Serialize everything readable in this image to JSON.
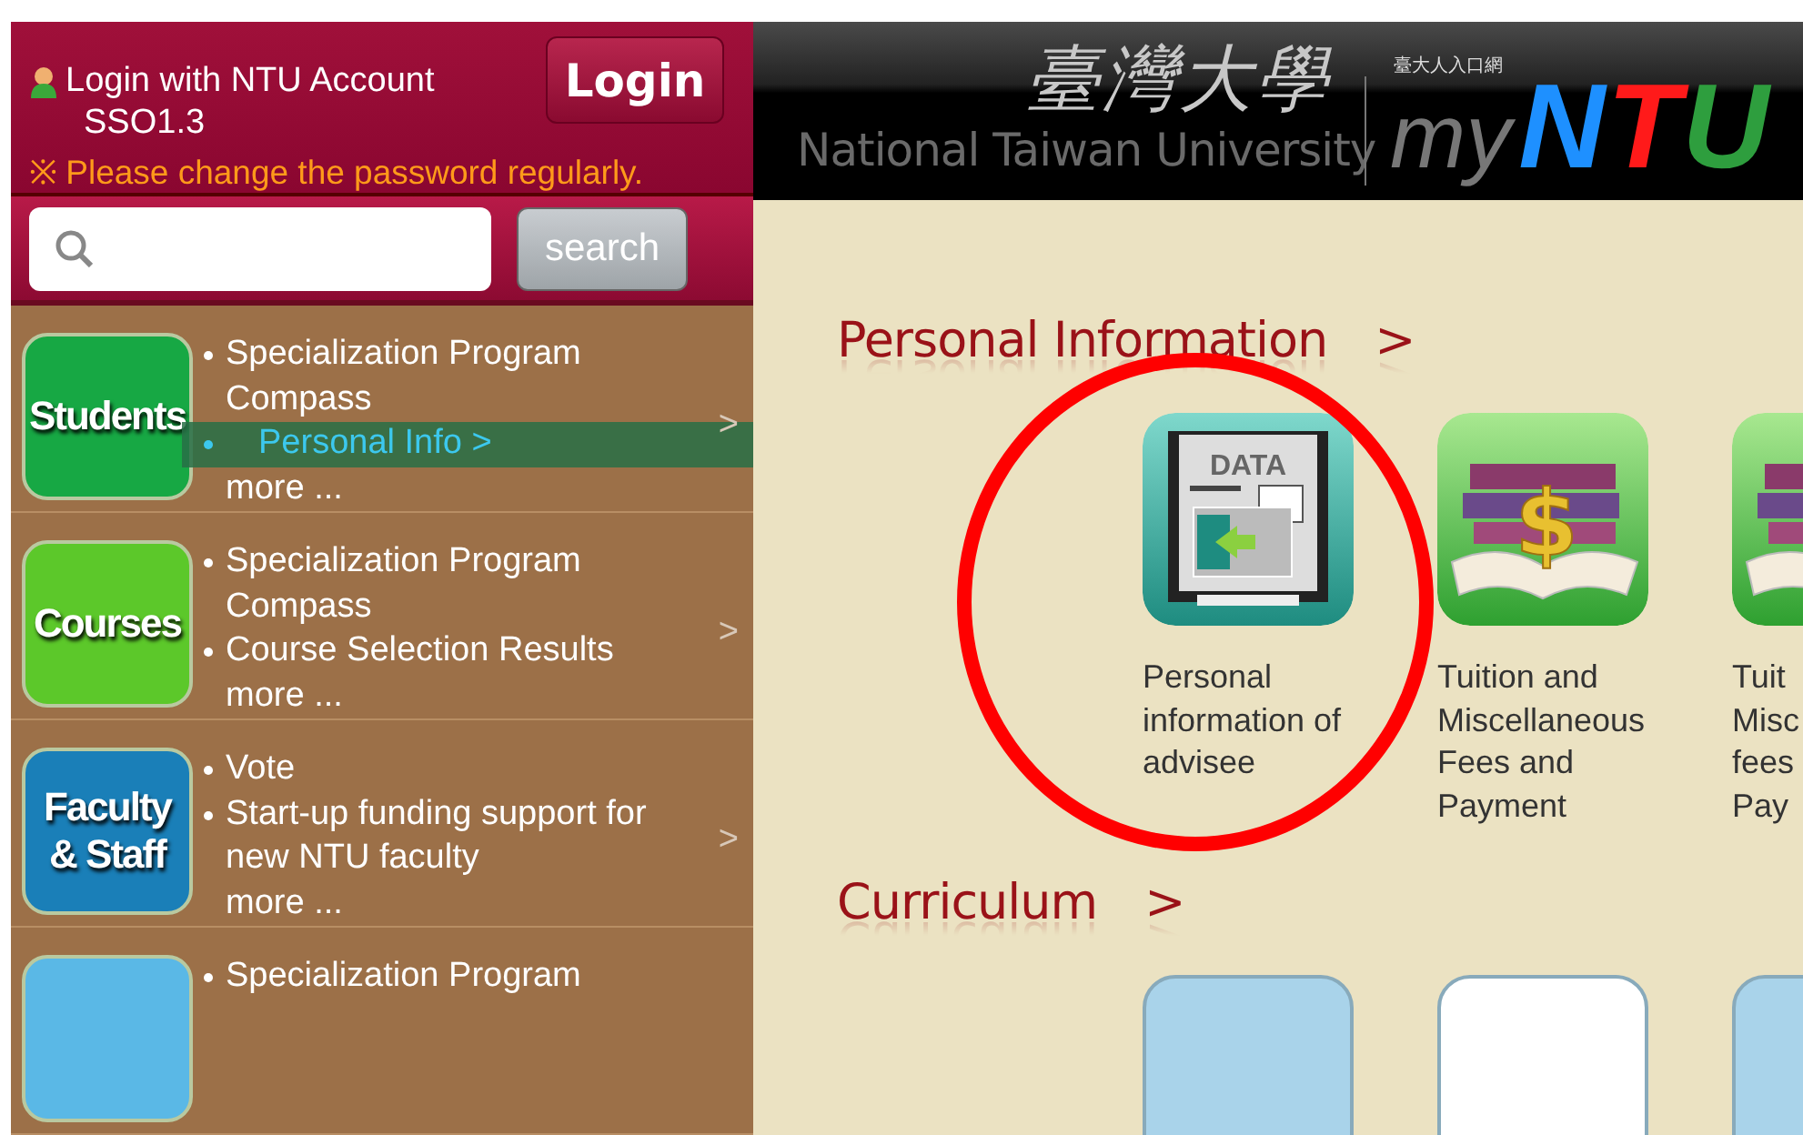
{
  "login": {
    "label": "Login with NTU Account",
    "version": "SSO1.3",
    "notice": "※ Please change the password regularly.",
    "button": "Login"
  },
  "search": {
    "button": "search"
  },
  "menu": [
    {
      "label": "Students",
      "color": "#17a844",
      "items": [
        {
          "text": "Specialization Program Compass",
          "selected": false
        },
        {
          "text": "Personal Info >",
          "selected": true
        }
      ],
      "more": "more ...",
      "arrow": ">"
    },
    {
      "label": "Courses",
      "color": "#5cc82a",
      "items": [
        {
          "text": "Specialization Program Compass",
          "selected": false
        },
        {
          "text": "Course Selection Results",
          "selected": false
        }
      ],
      "more": "more ...",
      "arrow": ">"
    },
    {
      "label": "Faculty & Staff",
      "color": "#1a7fb8",
      "items": [
        {
          "text": "Vote",
          "selected": false
        },
        {
          "text": "Start-up funding support for new NTU faculty",
          "selected": false
        }
      ],
      "more": "more ...",
      "arrow": ">"
    },
    {
      "color": "#5ab8e6",
      "items": [
        {
          "text": "Specialization Program",
          "selected": false
        }
      ]
    }
  ],
  "banner": {
    "university": "National Taiwan University",
    "calligraphy": "臺灣大學",
    "portal": "臺大人入口網",
    "brand_prefix": "my",
    "brand": [
      "N",
      "T",
      "U"
    ]
  },
  "sections": [
    {
      "title": "Personal Information",
      "arrow": ">",
      "tiles": [
        {
          "kind": "data",
          "icon_text": "DATA",
          "label": "Personal\ninformation of\nadvisee"
        },
        {
          "kind": "fees",
          "icon_text": "$",
          "label": "Tuition and\nMiscellaneous\nFees and\nPayment"
        },
        {
          "kind": "fees",
          "label": "Tuit\nMisc\nfees\nPay"
        }
      ]
    },
    {
      "title": "Curriculum",
      "arrow": ">",
      "tiles": [
        {
          "kind": "plain",
          "color": "#a9d3ea"
        },
        {
          "kind": "plain",
          "color": "#ffffff"
        },
        {
          "kind": "plain",
          "color": "#a9d3ea"
        }
      ]
    }
  ],
  "highlight_circle": true
}
